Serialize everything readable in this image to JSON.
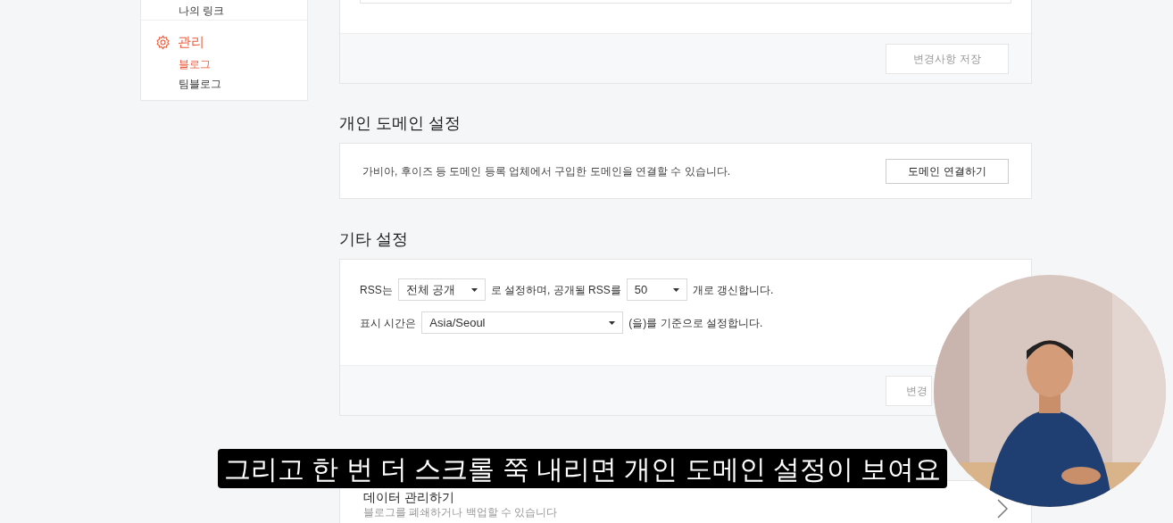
{
  "sidebar": {
    "top_item": "나의 링크",
    "section": {
      "title": "관리",
      "selected": true,
      "items": [
        {
          "label": "블로그",
          "selected": true
        },
        {
          "label": "팀블로그",
          "selected": false
        }
      ]
    }
  },
  "top_card": {
    "save_button": "변경사항 저장"
  },
  "domain": {
    "heading": "개인 도메인 설정",
    "description": "가비아, 후이즈 등 도메인 등록 업체에서 구입한 도메인을 연결할 수 있습니다.",
    "button": "도메인 연결하기"
  },
  "other": {
    "heading": "기타 설정",
    "rss_label": "RSS는",
    "rss_visibility": "전체 공개",
    "rss_middle": "로 설정하며, 공개될 RSS를",
    "rss_count": "50",
    "rss_suffix": "개로 갱신합니다.",
    "time_label": "표시 시간은",
    "timezone": "Asia/Seoul",
    "time_suffix": "(을)를 기준으로 설정합니다.",
    "save_button": "변경"
  },
  "data": {
    "title": "데이터 관리하기",
    "description": "블로그를 폐쇄하거나 백업할 수 있습니다"
  },
  "subtitle": "그리고 한 번 더 스크롤 쭉 내리면 개인 도메인 설정이 보여요"
}
